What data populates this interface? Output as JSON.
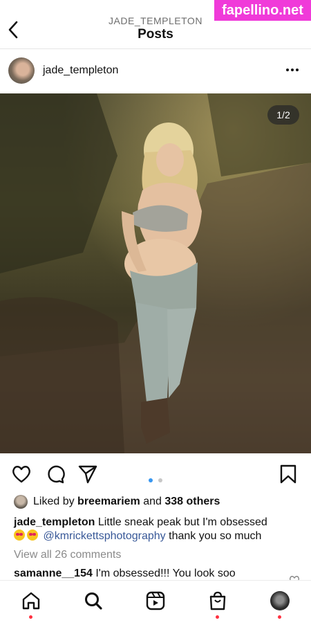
{
  "watermark": "fapellino.net",
  "header": {
    "username": "JADE_TEMPLETON",
    "title": "Posts"
  },
  "post": {
    "username": "jade_templeton",
    "image_counter": "1/2",
    "carousel": {
      "total": 2,
      "current": 1
    },
    "likes": {
      "prefix": "Liked by",
      "liker": "breemariem",
      "connector": "and",
      "others": "338 others"
    },
    "caption": {
      "username": "jade_templeton",
      "text": "Little sneak peak but I'm obsessed",
      "mention": "@kmricketts",
      "mention_rest": "photography",
      "suffix": "thank you so much"
    },
    "view_comments": "View all 26 comments",
    "comment": {
      "username": "samanne__154",
      "text": "I'm obsessed!!! You look soo"
    }
  },
  "icons": {
    "header": [
      "back-arrow-icon",
      "more-options-icon"
    ],
    "actions": [
      "heart-icon",
      "comment-icon",
      "share-icon",
      "bookmark-icon"
    ],
    "tabs": [
      "home-icon",
      "search-icon",
      "reels-icon",
      "shop-icon",
      "profile-avatar"
    ]
  },
  "colors": {
    "accent_blue": "#3897f0",
    "mention": "#385898",
    "watermark": "#f03ad9",
    "notification_dot": "#ff3040"
  }
}
